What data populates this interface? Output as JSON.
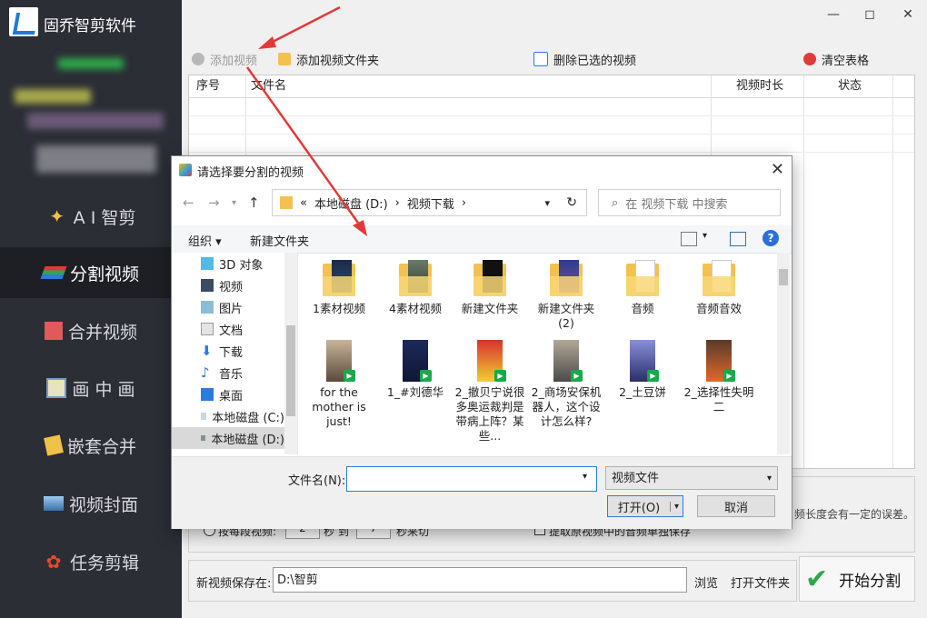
{
  "sidebar": {
    "app_title": "固乔智剪软件",
    "items": [
      {
        "label": "A I 智剪",
        "icon": "ai-magic-icon"
      },
      {
        "label": "分割视频",
        "icon": "split-video-icon"
      },
      {
        "label": "合并视频",
        "icon": "merge-video-icon"
      },
      {
        "label": "画 中 画",
        "icon": "picture-in-picture-icon"
      },
      {
        "label": "嵌套合并",
        "icon": "nested-merge-icon"
      },
      {
        "label": "视频封面",
        "icon": "video-cover-icon"
      },
      {
        "label": "任务剪辑",
        "icon": "task-edit-icon"
      }
    ]
  },
  "toolbar": {
    "add_video": "添加视频",
    "add_folder": "添加视频文件夹",
    "delete_selected": "删除已选的视频",
    "clear_table": "清空表格"
  },
  "table": {
    "columns": [
      "序号",
      "文件名",
      "视频时长",
      "状态"
    ]
  },
  "options": {
    "hint_tail": "频长度会有一定的误差。",
    "by_segment": "按每段视频:",
    "from_val": "2",
    "seconds_to": "秒 到",
    "to_val": "7",
    "seconds_cut": "秒来切",
    "extract_audio": "提取原视频中的音频单独保存"
  },
  "save": {
    "label": "新视频保存在:",
    "path": "D:\\智剪",
    "browse": "浏览",
    "open_folder": "打开文件夹"
  },
  "start_button": "开始分割",
  "dialog": {
    "title": "请选择要分割的视频",
    "breadcrumb": [
      "«",
      "本地磁盘 (D:)",
      "›",
      "视频下载",
      "›"
    ],
    "search_placeholder": "在 视频下载 中搜索",
    "organize": "组织 ▾",
    "new_folder": "新建文件夹",
    "nav": [
      "3D 对象",
      "视频",
      "图片",
      "文档",
      "下载",
      "音乐",
      "桌面",
      "本地磁盘 (C:)",
      "本地磁盘 (D:)"
    ],
    "folders": [
      "1素材视频",
      "4素材视频",
      "新建文件夹",
      "新建文件夹 (2)",
      "音频",
      "音频音效"
    ],
    "videos": [
      "for the mother is just!",
      "1_#刘德华",
      "2_撤贝宁说很多奥运裁判是带病上阵？某些...",
      "2_商场安保机器人，这个设计怎么样?",
      "2_土豆饼",
      "2_选择性失明二"
    ],
    "filename_label": "文件名(N):",
    "filename_value": "",
    "filetype": "视频文件",
    "open": "打开(O)",
    "cancel": "取消"
  },
  "colors": {
    "sidebar_bg": "#2b2e35",
    "accent_red": "#e23a3a"
  }
}
